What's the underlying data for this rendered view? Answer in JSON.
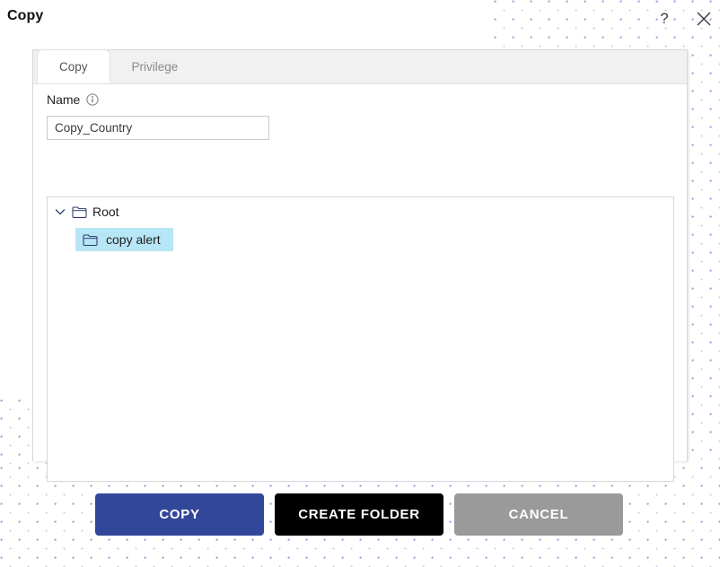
{
  "window": {
    "title": "Copy",
    "help_icon": "question-mark-icon",
    "close_icon": "close-x-icon"
  },
  "tabs": [
    {
      "label": "Copy",
      "active": true
    },
    {
      "label": "Privilege",
      "active": false
    }
  ],
  "form": {
    "name_label": "Name",
    "info_icon": "info-circle-icon",
    "name_value": "Copy_Country",
    "name_placeholder": "Name"
  },
  "tree": {
    "nodes": [
      {
        "label": "Root",
        "chevron": "chevron-down-icon",
        "icon": "folder-icon",
        "expanded": true,
        "selected": false,
        "depth": 0
      },
      {
        "label": "copy alert",
        "icon": "folder-icon",
        "expanded": false,
        "selected": true,
        "depth": 1
      }
    ]
  },
  "buttons": [
    {
      "label": "COPY",
      "color": "#33479a"
    },
    {
      "label": "CREATE FOLDER",
      "color": "#000000"
    },
    {
      "label": "CANCEL",
      "color": "#9a9a9a"
    }
  ],
  "colors": {
    "accent_blue": "#33479a",
    "selection_blue": "#b7e6f7",
    "tab_bar_gray": "#f1f1f1",
    "dot_pattern_blue": "#9aa8e0"
  }
}
